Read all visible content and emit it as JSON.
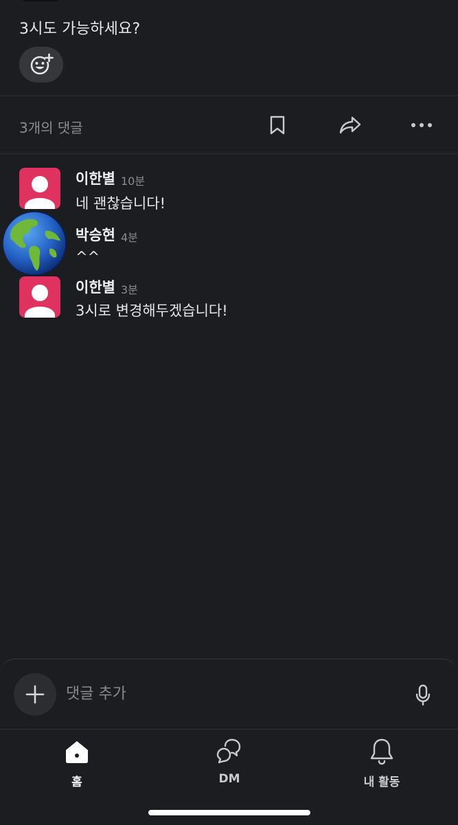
{
  "post": {
    "message": "3시도 가능하세요?",
    "reaction_icon": "add-reaction-icon"
  },
  "thread_bar": {
    "comment_count": "3개의 댓글",
    "icons": [
      "bookmark-icon",
      "share-icon",
      "more-icon"
    ]
  },
  "comments": [
    {
      "name": "이한별",
      "time": "10분",
      "text": "네 괜찮습니다!",
      "avatar": "default-user-avatar"
    },
    {
      "name": "박승현",
      "time": "4분",
      "text": "^^",
      "avatar": "globe-avatar"
    },
    {
      "name": "이한별",
      "time": "3분",
      "text": "3시로 변경해두겠습니다!",
      "avatar": "default-user-avatar"
    }
  ],
  "composer": {
    "placeholder": "댓글 추가",
    "add_icon": "plus-icon",
    "mic_icon": "microphone-icon"
  },
  "nav": {
    "home": "홈",
    "dm": "DM",
    "activity": "내 활동"
  },
  "colors": {
    "background": "#1b1d21",
    "avatar_pink": "#e0325f",
    "muted_text": "#8a8b8e"
  }
}
